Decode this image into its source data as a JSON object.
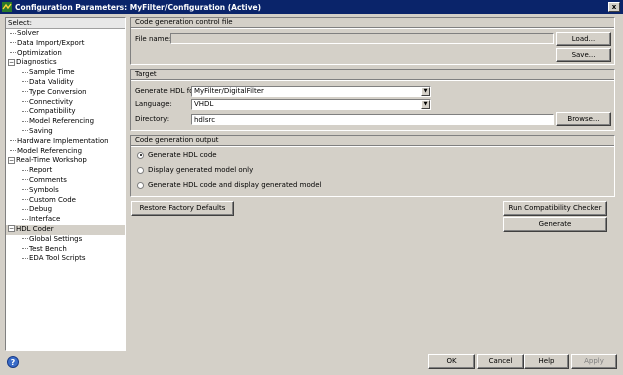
{
  "window": {
    "title": "Configuration Parameters: MyFilter/Configuration (Active)",
    "close_label": "x"
  },
  "tree": {
    "header": "Select:",
    "items": [
      {
        "label": "Solver",
        "level": 1,
        "expander": ""
      },
      {
        "label": "Data Import/Export",
        "level": 1,
        "expander": ""
      },
      {
        "label": "Optimization",
        "level": 1,
        "expander": ""
      },
      {
        "label": "Diagnostics",
        "level": 0,
        "expander": "−"
      },
      {
        "label": "Sample Time",
        "level": 2,
        "expander": ""
      },
      {
        "label": "Data Validity",
        "level": 2,
        "expander": ""
      },
      {
        "label": "Type Conversion",
        "level": 2,
        "expander": ""
      },
      {
        "label": "Connectivity",
        "level": 2,
        "expander": ""
      },
      {
        "label": "Compatibility",
        "level": 2,
        "expander": ""
      },
      {
        "label": "Model Referencing",
        "level": 2,
        "expander": ""
      },
      {
        "label": "Saving",
        "level": 2,
        "expander": ""
      },
      {
        "label": "Hardware Implementation",
        "level": 1,
        "expander": ""
      },
      {
        "label": "Model Referencing",
        "level": 1,
        "expander": ""
      },
      {
        "label": "Real-Time Workshop",
        "level": 0,
        "expander": "−"
      },
      {
        "label": "Report",
        "level": 2,
        "expander": ""
      },
      {
        "label": "Comments",
        "level": 2,
        "expander": ""
      },
      {
        "label": "Symbols",
        "level": 2,
        "expander": ""
      },
      {
        "label": "Custom Code",
        "level": 2,
        "expander": ""
      },
      {
        "label": "Debug",
        "level": 2,
        "expander": ""
      },
      {
        "label": "Interface",
        "level": 2,
        "expander": ""
      },
      {
        "label": "HDL Coder",
        "level": 0,
        "expander": "−",
        "selected": true
      },
      {
        "label": "Global Settings",
        "level": 2,
        "expander": ""
      },
      {
        "label": "Test Bench",
        "level": 2,
        "expander": ""
      },
      {
        "label": "EDA Tool Scripts",
        "level": 2,
        "expander": ""
      }
    ]
  },
  "control_file": {
    "title": "Code generation control file",
    "file_name_label": "File name:",
    "file_name_value": "",
    "load_label": "Load...",
    "save_label": "Save..."
  },
  "target": {
    "title": "Target",
    "generate_for_label": "Generate HDL for:",
    "generate_for_value": "MyFilter/DigitalFilter",
    "language_label": "Language:",
    "language_value": "VHDL",
    "directory_label": "Directory:",
    "directory_value": "hdlsrc",
    "browse_label": "Browse..."
  },
  "output": {
    "title": "Code generation output",
    "options": [
      {
        "label": "Generate HDL code",
        "checked": true
      },
      {
        "label": "Display generated model only",
        "checked": false
      },
      {
        "label": "Generate HDL code and display generated model",
        "checked": false
      }
    ]
  },
  "actions": {
    "restore_label": "Restore Factory Defaults",
    "compat_label": "Run Compatibility Checker",
    "generate_label": "Generate"
  },
  "footer": {
    "help_icon_glyph": "?",
    "ok_label": "OK",
    "cancel_label": "Cancel",
    "help_label": "Help",
    "apply_label": "Apply"
  }
}
